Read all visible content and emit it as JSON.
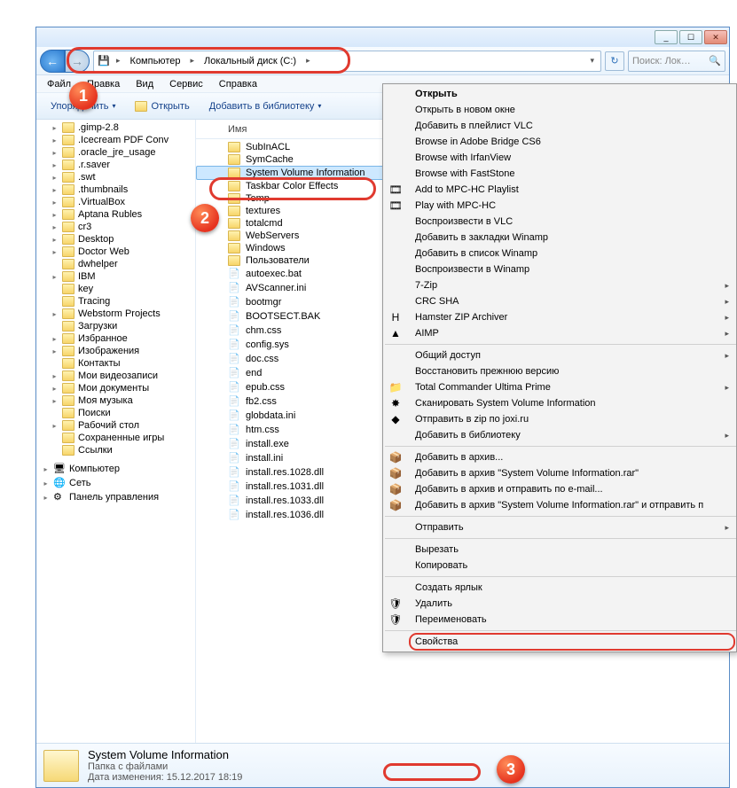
{
  "titlebar": {
    "min": "_",
    "max": "☐",
    "close": "✕"
  },
  "nav": {
    "crumb1": "Компьютер",
    "crumb2": "Локальный диск (C:)",
    "search_placeholder": "Поиск: Лок…"
  },
  "menubar": [
    "Файл",
    "Правка",
    "Вид",
    "Сервис",
    "Справка"
  ],
  "toolbar": {
    "organize": "Упорядочить",
    "open": "Открыть",
    "include": "Добавить в библиотеку"
  },
  "list_header": "Имя",
  "tree": [
    {
      "t": ".gimp-2.8",
      "e": "▸"
    },
    {
      "t": ".Icecream PDF Conv",
      "e": "▸"
    },
    {
      "t": ".oracle_jre_usage",
      "e": "▸"
    },
    {
      "t": ".r.saver",
      "e": "▸"
    },
    {
      "t": ".swt",
      "e": "▸"
    },
    {
      "t": ".thumbnails",
      "e": "▸"
    },
    {
      "t": ".VirtualBox",
      "e": "▸"
    },
    {
      "t": "Aptana Rubles",
      "e": "▸"
    },
    {
      "t": "cr3",
      "e": "▸"
    },
    {
      "t": "Desktop",
      "e": "▸"
    },
    {
      "t": "Doctor Web",
      "e": "▸"
    },
    {
      "t": "dwhelper",
      "e": ""
    },
    {
      "t": "IBM",
      "e": "▸"
    },
    {
      "t": "key",
      "e": ""
    },
    {
      "t": "Tracing",
      "e": ""
    },
    {
      "t": "Webstorm Projects",
      "e": "▸"
    },
    {
      "t": "Загрузки",
      "e": ""
    },
    {
      "t": "Избранное",
      "e": "▸"
    },
    {
      "t": "Изображения",
      "e": "▸"
    },
    {
      "t": "Контакты",
      "e": ""
    },
    {
      "t": "Мои видеозаписи",
      "e": "▸"
    },
    {
      "t": "Мои документы",
      "e": "▸"
    },
    {
      "t": "Моя музыка",
      "e": "▸"
    },
    {
      "t": "Поиски",
      "e": ""
    },
    {
      "t": "Рабочий стол",
      "e": "▸"
    },
    {
      "t": "Сохраненные игры",
      "e": ""
    },
    {
      "t": "Ссылки",
      "e": ""
    }
  ],
  "tree_extra": {
    "computer": "Компьютер",
    "network": "Сеть",
    "control": "Панель управления"
  },
  "files": [
    {
      "t": "SubInACL",
      "k": "folder"
    },
    {
      "t": "SymCache",
      "k": "folder"
    },
    {
      "t": "System Volume Information",
      "k": "folder",
      "sel": true
    },
    {
      "t": "Taskbar Color Effects",
      "k": "folder"
    },
    {
      "t": "Temp",
      "k": "folder"
    },
    {
      "t": "textures",
      "k": "folder"
    },
    {
      "t": "totalcmd",
      "k": "folder"
    },
    {
      "t": "WebServers",
      "k": "folder"
    },
    {
      "t": "Windows",
      "k": "folder"
    },
    {
      "t": "Пользователи",
      "k": "folder"
    },
    {
      "t": "autoexec.bat",
      "k": "file"
    },
    {
      "t": "AVScanner.ini",
      "k": "file"
    },
    {
      "t": "bootmgr",
      "k": "file"
    },
    {
      "t": "BOOTSECT.BAK",
      "k": "file"
    },
    {
      "t": "chm.css",
      "k": "file"
    },
    {
      "t": "config.sys",
      "k": "file"
    },
    {
      "t": "doc.css",
      "k": "file"
    },
    {
      "t": "end",
      "k": "file"
    },
    {
      "t": "epub.css",
      "k": "file"
    },
    {
      "t": "fb2.css",
      "k": "file"
    },
    {
      "t": "globdata.ini",
      "k": "file"
    },
    {
      "t": "htm.css",
      "k": "file"
    },
    {
      "t": "install.exe",
      "k": "file"
    },
    {
      "t": "install.ini",
      "k": "file"
    },
    {
      "t": "install.res.1028.dll",
      "k": "file"
    },
    {
      "t": "install.res.1031.dll",
      "k": "file"
    },
    {
      "t": "install.res.1033.dll",
      "k": "file"
    },
    {
      "t": "install.res.1036.dll",
      "k": "file"
    }
  ],
  "details": {
    "name": "System Volume Information",
    "type": "Папка с файлами",
    "date_label": "Дата изменения:",
    "date": "15.12.2017 18:19"
  },
  "ctx": [
    {
      "t": "Открыть",
      "bold": true
    },
    {
      "t": "Открыть в новом окне"
    },
    {
      "t": "Добавить в плейлист VLC"
    },
    {
      "t": "Browse in Adobe Bridge CS6"
    },
    {
      "t": "Browse with IrfanView"
    },
    {
      "t": "Browse with FastStone"
    },
    {
      "t": "Add to MPC-HC Playlist",
      "ico": "🎞"
    },
    {
      "t": "Play with MPC-HC",
      "ico": "🎞"
    },
    {
      "t": "Воспроизвести в VLC"
    },
    {
      "t": "Добавить в закладки Winamp"
    },
    {
      "t": "Добавить в список Winamp"
    },
    {
      "t": "Воспроизвести в Winamp"
    },
    {
      "t": "7-Zip",
      "sub": true
    },
    {
      "t": "CRC SHA",
      "sub": true
    },
    {
      "t": "Hamster ZIP Archiver",
      "ico": "H",
      "sub": true
    },
    {
      "t": "AIMP",
      "ico": "▲",
      "sub": true
    },
    {
      "sep": true
    },
    {
      "t": "Общий доступ",
      "sub": true
    },
    {
      "t": "Восстановить прежнюю версию"
    },
    {
      "t": "Total Commander Ultima Prime",
      "ico": "📁",
      "sub": true
    },
    {
      "t": "Сканировать System Volume Information",
      "ico": "✸"
    },
    {
      "t": "Отправить в zip по joxi.ru",
      "ico": "◆"
    },
    {
      "t": "Добавить в библиотеку",
      "sub": true
    },
    {
      "sep": true
    },
    {
      "t": "Добавить в архив...",
      "ico": "📦"
    },
    {
      "t": "Добавить в архив \"System Volume Information.rar\"",
      "ico": "📦"
    },
    {
      "t": "Добавить в архив и отправить по e-mail...",
      "ico": "📦"
    },
    {
      "t": "Добавить в архив \"System Volume Information.rar\" и отправить п",
      "ico": "📦"
    },
    {
      "sep": true
    },
    {
      "t": "Отправить",
      "sub": true
    },
    {
      "sep": true
    },
    {
      "t": "Вырезать"
    },
    {
      "t": "Копировать"
    },
    {
      "sep": true
    },
    {
      "t": "Создать ярлык"
    },
    {
      "t": "Удалить",
      "ico": "🛡"
    },
    {
      "t": "Переименовать",
      "ico": "🛡"
    },
    {
      "sep": true
    },
    {
      "t": "Свойства",
      "hl": true
    }
  ],
  "badges": {
    "b1": "1",
    "b2": "2",
    "b3": "3"
  }
}
